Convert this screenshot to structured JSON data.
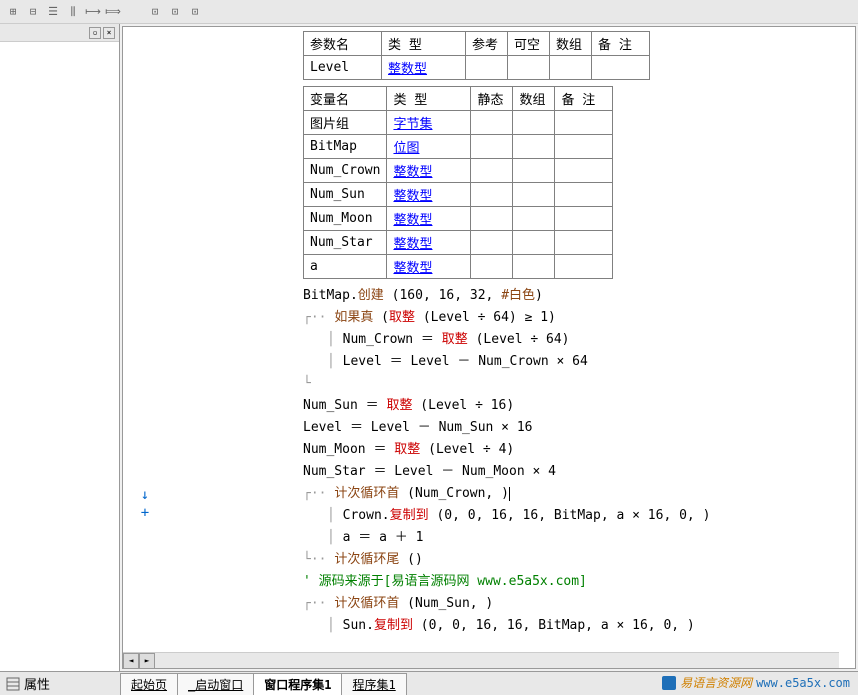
{
  "params_table": {
    "headers": [
      "参数名",
      "类 型",
      "参考",
      "可空",
      "数组",
      "备 注"
    ],
    "rows": [
      {
        "name": "Level",
        "type": "整数型"
      }
    ]
  },
  "vars_table": {
    "headers": [
      "变量名",
      "类 型",
      "静态",
      "数组",
      "备 注"
    ],
    "rows": [
      {
        "name": "图片组",
        "type": "字节集"
      },
      {
        "name": "BitMap",
        "type": "位图"
      },
      {
        "name": "Num_Crown",
        "type": "整数型"
      },
      {
        "name": "Num_Sun",
        "type": "整数型"
      },
      {
        "name": "Num_Moon",
        "type": "整数型"
      },
      {
        "name": "Num_Star",
        "type": "整数型"
      },
      {
        "name": "a",
        "type": "整数型"
      }
    ]
  },
  "code": {
    "l1_obj": "BitMap.",
    "l1_method": "创建",
    "l1_args": " (160, 16, 32, ",
    "l1_const": "#白色",
    "l1_end": ")",
    "l2_kw": "如果真",
    "l2_open": " (",
    "l2_fn": "取整",
    "l2_args": " (Level ÷ 64) ≥ 1)",
    "l3_lhs": "Num_Crown ＝ ",
    "l3_fn": "取整",
    "l3_args": " (Level ÷ 64)",
    "l4": "Level ＝ Level － Num_Crown × 64",
    "l5_lhs": "Num_Sun ＝ ",
    "l5_fn": "取整",
    "l5_args": " (Level ÷ 16)",
    "l6": "Level ＝ Level － Num_Sun × 16",
    "l7_lhs": "Num_Moon ＝ ",
    "l7_fn": "取整",
    "l7_args": " (Level ÷ 4)",
    "l8": "Num_Star ＝ Level － Num_Moon × 4",
    "l9_kw": "计次循环首",
    "l9_args": " (Num_Crown, )",
    "l10_obj": "Crown.",
    "l10_method": "复制到",
    "l10_args": " (0, 0, 16, 16, BitMap, a × 16, 0, )",
    "l11": "a ＝ a ＋ 1",
    "l12_kw": "计次循环尾",
    "l12_args": " ()",
    "l13_comment": "' 源码来源于[易语言源码网 www.e5a5x.com]",
    "l14_kw": "计次循环首",
    "l14_args": " (Num_Sun, )",
    "l15_obj": "Sun.",
    "l15_method": "复制到",
    "l15_args": " (0, 0, 16, 16, BitMap, a × 16, 0, )"
  },
  "bottom": {
    "prop_label": "属性",
    "tabs": [
      "起始页",
      "_启动窗口",
      "窗口程序集1",
      "程序集1"
    ],
    "active_tab": 2
  },
  "watermark": {
    "cn": "易语言资源网",
    "url": "www.e5a5x.com"
  },
  "gutter": {
    "arrow": "↓",
    "plus": "+"
  }
}
